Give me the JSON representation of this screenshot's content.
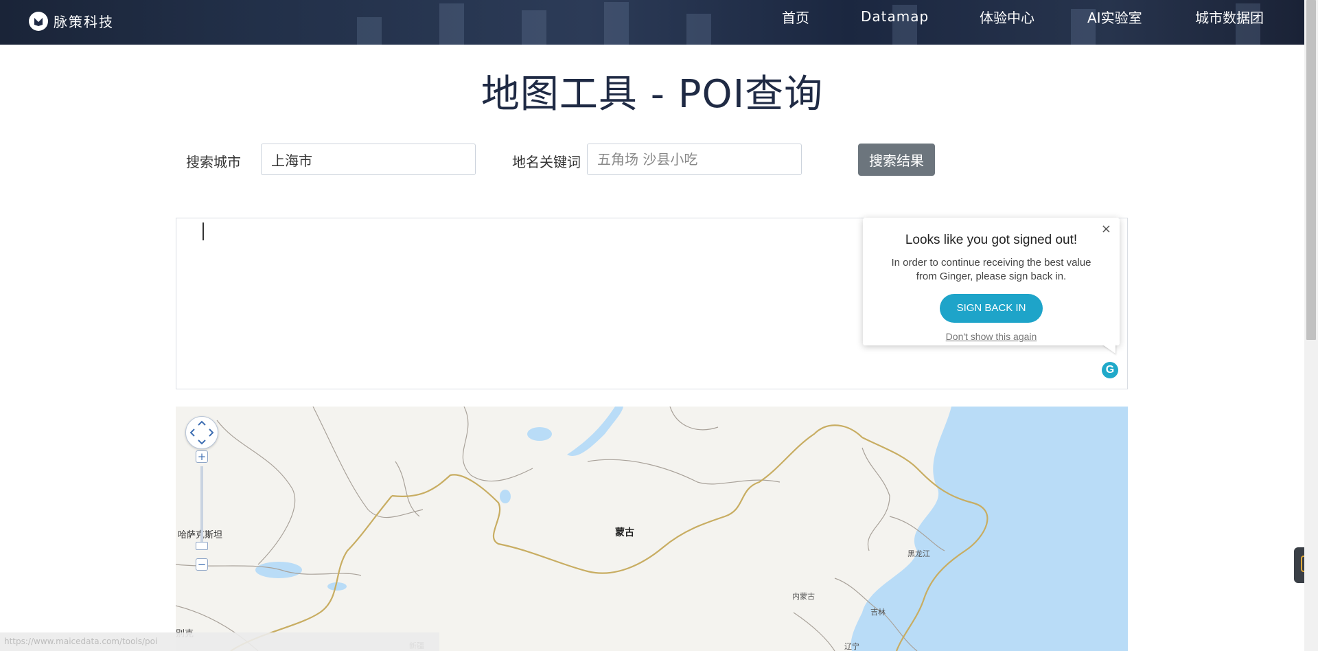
{
  "header": {
    "brand": "脉策科技",
    "nav": [
      {
        "label": "首页"
      },
      {
        "label": "Datamap"
      },
      {
        "label": "体验中心"
      },
      {
        "label": "AI实验室"
      },
      {
        "label": "城市数据团"
      }
    ]
  },
  "page": {
    "title": "地图工具 - POI查询"
  },
  "form": {
    "city_label": "搜索城市",
    "city_value": "上海市",
    "keyword_label": "地名关键词",
    "keyword_placeholder": "五角场 沙县小吃",
    "search_button": "搜索结果"
  },
  "ginger_popup": {
    "close": "×",
    "title": "Looks like you got signed out!",
    "message": "In order to continue receiving the best value from Ginger, please sign back in.",
    "button": "SIGN BACK IN",
    "dont_show": "Don't show this again",
    "badge": "G"
  },
  "map": {
    "labels": [
      {
        "text": "哈萨克斯坦",
        "style": "normal"
      },
      {
        "text": "蒙古",
        "style": "bold"
      },
      {
        "text": "黑龙江",
        "style": "small"
      },
      {
        "text": "内蒙古",
        "style": "small"
      },
      {
        "text": "吉林",
        "style": "small"
      },
      {
        "text": "辽宁",
        "style": "small"
      },
      {
        "text": "别克",
        "style": "normal"
      },
      {
        "text": "新疆",
        "style": "small"
      }
    ],
    "zoom_in": "+",
    "zoom_out": "−",
    "colors": {
      "land": "#f4f3ef",
      "water": "#b9dcf7",
      "border_national": "#c8ad62",
      "border_province": "#9a9a9a"
    }
  },
  "statusbar": {
    "text": "https://www.maicedata.com/tools/poi"
  }
}
